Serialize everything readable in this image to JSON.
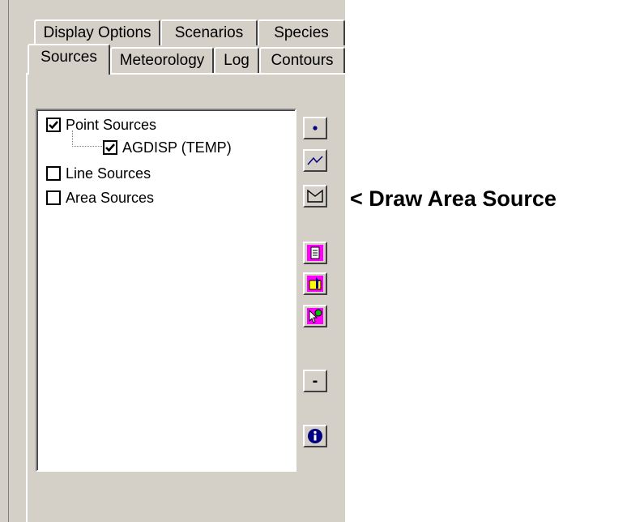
{
  "tabs_row1": [
    {
      "label": "Display Options"
    },
    {
      "label": "Scenarios"
    },
    {
      "label": "Species"
    }
  ],
  "tabs_row2": [
    {
      "label": "Sources",
      "active": true
    },
    {
      "label": "Meteorology"
    },
    {
      "label": "Log"
    },
    {
      "label": "Contours"
    }
  ],
  "tree": [
    {
      "label": "Point Sources",
      "checked": true
    },
    {
      "label": "AGDISP (TEMP)",
      "checked": true
    },
    {
      "label": "Line Sources",
      "checked": false
    },
    {
      "label": "Area Sources",
      "checked": false
    }
  ],
  "toolbar": {
    "icons": [
      "point-source-icon",
      "line-source-icon",
      "area-source-icon",
      "properties-icon",
      "import-icon",
      "select-icon",
      "remove-icon",
      "info-icon"
    ],
    "remove_label": "-"
  },
  "annotation": "< Draw Area Source",
  "colors": {
    "face": "#d4d0c8",
    "magenta": "#ff00ff",
    "blue": "#000080"
  }
}
